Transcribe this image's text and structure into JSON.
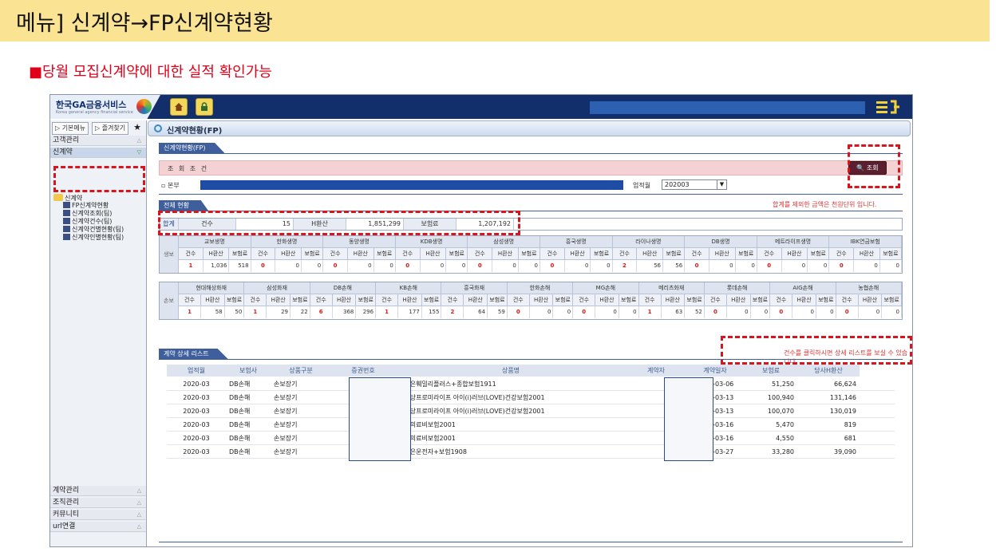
{
  "banner": {
    "title": "메뉴] 신계약→FP신계약현황"
  },
  "note": "■당월 모집신계약에 대한 실적 확인가능",
  "topbar": {
    "logo_text": "한국GA금융서비스",
    "logo_sub": "Korea general agency financial service",
    "home_icon": "home-icon",
    "lock_icon": "lock-icon",
    "menu_icon": "menu-toggle-icon"
  },
  "sidebar": {
    "basic_menu": "▷ 기본메뉴",
    "favorites": "▷ 즐겨찾기",
    "favorite_star": "★",
    "sections_top": [
      "고객관리",
      "신계약"
    ],
    "tree_root": "신계약",
    "tree_items": [
      "FP신계약현황",
      "신계약조회(팀)",
      "신계약건수(팀)",
      "신계약건별현황(팀)",
      "신계약인별현황(팀)"
    ],
    "sections_bottom": [
      "계약관리",
      "조직관리",
      "커뮤니티",
      "url연결"
    ]
  },
  "main": {
    "title": "신계약현황(FP)",
    "tab": "신계약현황(FP)",
    "cond_label": "조 회 조 건",
    "search_button": "조회",
    "bonbu_label": "본부",
    "month_label": "업적월",
    "month_value": "202003",
    "total_tab": "전체 현황",
    "unit_note": "합계를 제외한 금액은 천원단위 입니다.",
    "summary": {
      "label": "합계",
      "count_label": "건수",
      "count": "15",
      "hcalc_label": "H환산",
      "hcalc": "1,851,299",
      "premium_label": "보험료",
      "premium": "1,207,192"
    },
    "sub_headers": [
      "건수",
      "H환산",
      "보험료"
    ],
    "life": {
      "side": "생보",
      "companies": [
        {
          "name": "교보생명",
          "vals": [
            "1",
            "1,036",
            "518"
          ]
        },
        {
          "name": "한화생명",
          "vals": [
            "0",
            "0",
            "0"
          ]
        },
        {
          "name": "동양생명",
          "vals": [
            "0",
            "0",
            "0"
          ]
        },
        {
          "name": "KDB생명",
          "vals": [
            "0",
            "0",
            "0"
          ]
        },
        {
          "name": "삼성생명",
          "vals": [
            "0",
            "0",
            "0"
          ]
        },
        {
          "name": "흥국생명",
          "vals": [
            "0",
            "0",
            "0"
          ]
        },
        {
          "name": "라이나생명",
          "vals": [
            "2",
            "56",
            "56"
          ]
        },
        {
          "name": "DB생명",
          "vals": [
            "0",
            "0",
            "0"
          ]
        },
        {
          "name": "메트라이프생명",
          "vals": [
            "0",
            "0",
            "0"
          ]
        },
        {
          "name": "IBK연금보험",
          "vals": [
            "0",
            "0",
            "0"
          ]
        }
      ]
    },
    "nonlife": {
      "side": "손보",
      "companies": [
        {
          "name": "현대해상화재",
          "vals": [
            "1",
            "58",
            "50"
          ]
        },
        {
          "name": "삼성화재",
          "vals": [
            "1",
            "29",
            "22"
          ]
        },
        {
          "name": "DB손해",
          "vals": [
            "6",
            "368",
            "296"
          ]
        },
        {
          "name": "KB손해",
          "vals": [
            "1",
            "177",
            "155"
          ]
        },
        {
          "name": "흥국화재",
          "vals": [
            "2",
            "64",
            "59"
          ]
        },
        {
          "name": "한화손해",
          "vals": [
            "0",
            "0",
            "0"
          ]
        },
        {
          "name": "MG손해",
          "vals": [
            "0",
            "0",
            "0"
          ]
        },
        {
          "name": "메리츠화재",
          "vals": [
            "1",
            "63",
            "52"
          ]
        },
        {
          "name": "롯데손해",
          "vals": [
            "0",
            "0",
            "0"
          ]
        },
        {
          "name": "AIG손해",
          "vals": [
            "0",
            "0",
            "0"
          ]
        },
        {
          "name": "농협손해",
          "vals": [
            "0",
            "0",
            "0"
          ]
        }
      ]
    },
    "detail_tab": "계약 상세 리스트",
    "detail_note": "건수를 클릭하시면 상세 리스트를 보실 수 있습니다.",
    "detail_headers": [
      "업적월",
      "보험사",
      "상품구분",
      "증권번호",
      "상품명",
      "계약자",
      "계약일자",
      "보험료",
      "당사H환산"
    ],
    "detail_rows": [
      [
        "2020-03",
        "DB손해",
        "손보장기",
        "",
        "참좋은훼밀리플러스+종합보험1911",
        "",
        "2020-03-06",
        "51,250",
        "66,624"
      ],
      [
        "2020-03",
        "DB손해",
        "손보장기",
        "",
        "무배당프로미라이프 아이(i)러브(LOVE)건강보험2001",
        "",
        "2020-03-13",
        "100,940",
        "131,146"
      ],
      [
        "2020-03",
        "DB손해",
        "손보장기",
        "",
        "무배당프로미라이프 아이(i)러브(LOVE)건강보험2001",
        "",
        "2020-03-13",
        "100,070",
        "130,019"
      ],
      [
        "2020-03",
        "DB손해",
        "손보장기",
        "",
        "실손의료비보험2001",
        "",
        "2020-03-16",
        "5,470",
        "819"
      ],
      [
        "2020-03",
        "DB손해",
        "손보장기",
        "",
        "실손의료비보험2001",
        "",
        "2020-03-16",
        "4,550",
        "681"
      ],
      [
        "2020-03",
        "DB손해",
        "손보장기",
        "",
        "참좋은운전자+보험1908",
        "",
        "2020-03-27",
        "33,280",
        "39,090"
      ]
    ]
  },
  "colors": {
    "banner": "#fbe394",
    "note_red": "#e0001a",
    "topbar": "#122f6b",
    "highlight": "#d8141c"
  }
}
